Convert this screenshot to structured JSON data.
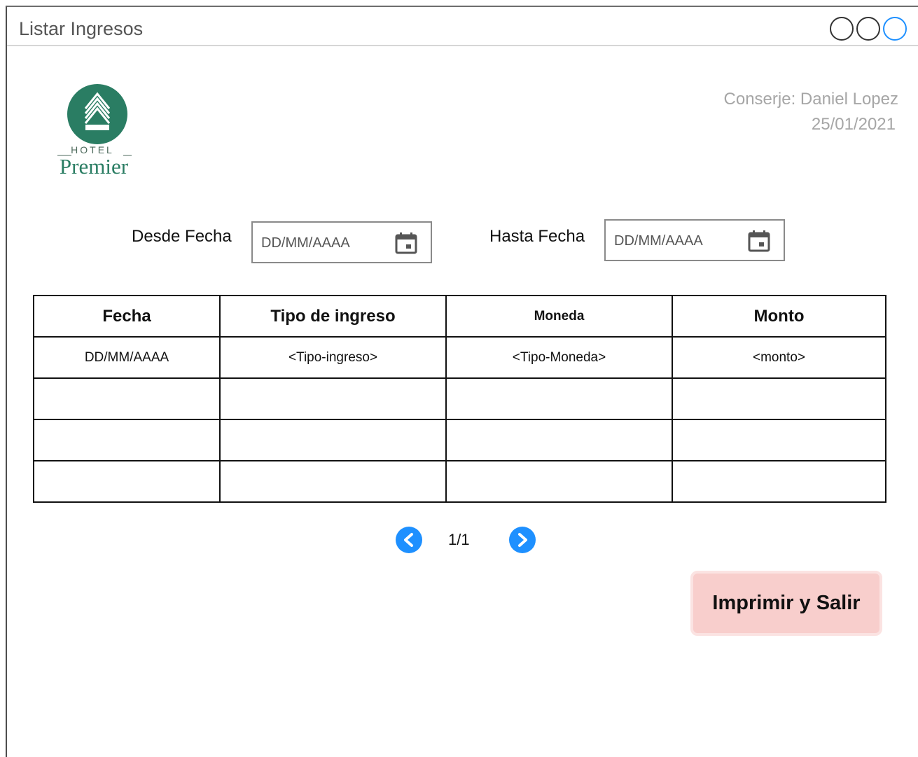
{
  "window": {
    "title": "Listar Ingresos"
  },
  "logo": {
    "small_text": "HOTEL",
    "big_text": "Premier",
    "brand_color": "#2a7d63"
  },
  "user": {
    "label": "Conserje: Daniel Lopez",
    "date": "25/01/2021"
  },
  "filters": {
    "from_label": "Desde Fecha",
    "from_placeholder": "DD/MM/AAAA",
    "to_label": "Hasta Fecha",
    "to_placeholder": "DD/MM/AAAA"
  },
  "table": {
    "headers": [
      "Fecha",
      "Tipo de ingreso",
      "Moneda",
      "Monto"
    ],
    "rows": [
      [
        "DD/MM/AAAA",
        "<Tipo-ingreso>",
        "<Tipo-Moneda>",
        "<monto>"
      ],
      [
        "",
        "",
        "",
        ""
      ],
      [
        "",
        "",
        "",
        ""
      ],
      [
        "",
        "",
        "",
        ""
      ]
    ]
  },
  "pager": {
    "text": "1/1",
    "prev_icon": "chevron-left-icon",
    "next_icon": "chevron-right-icon",
    "color": "#1e90ff"
  },
  "actions": {
    "print_exit_label": "Imprimir y Salir",
    "print_exit_color": "#f8cecc"
  }
}
